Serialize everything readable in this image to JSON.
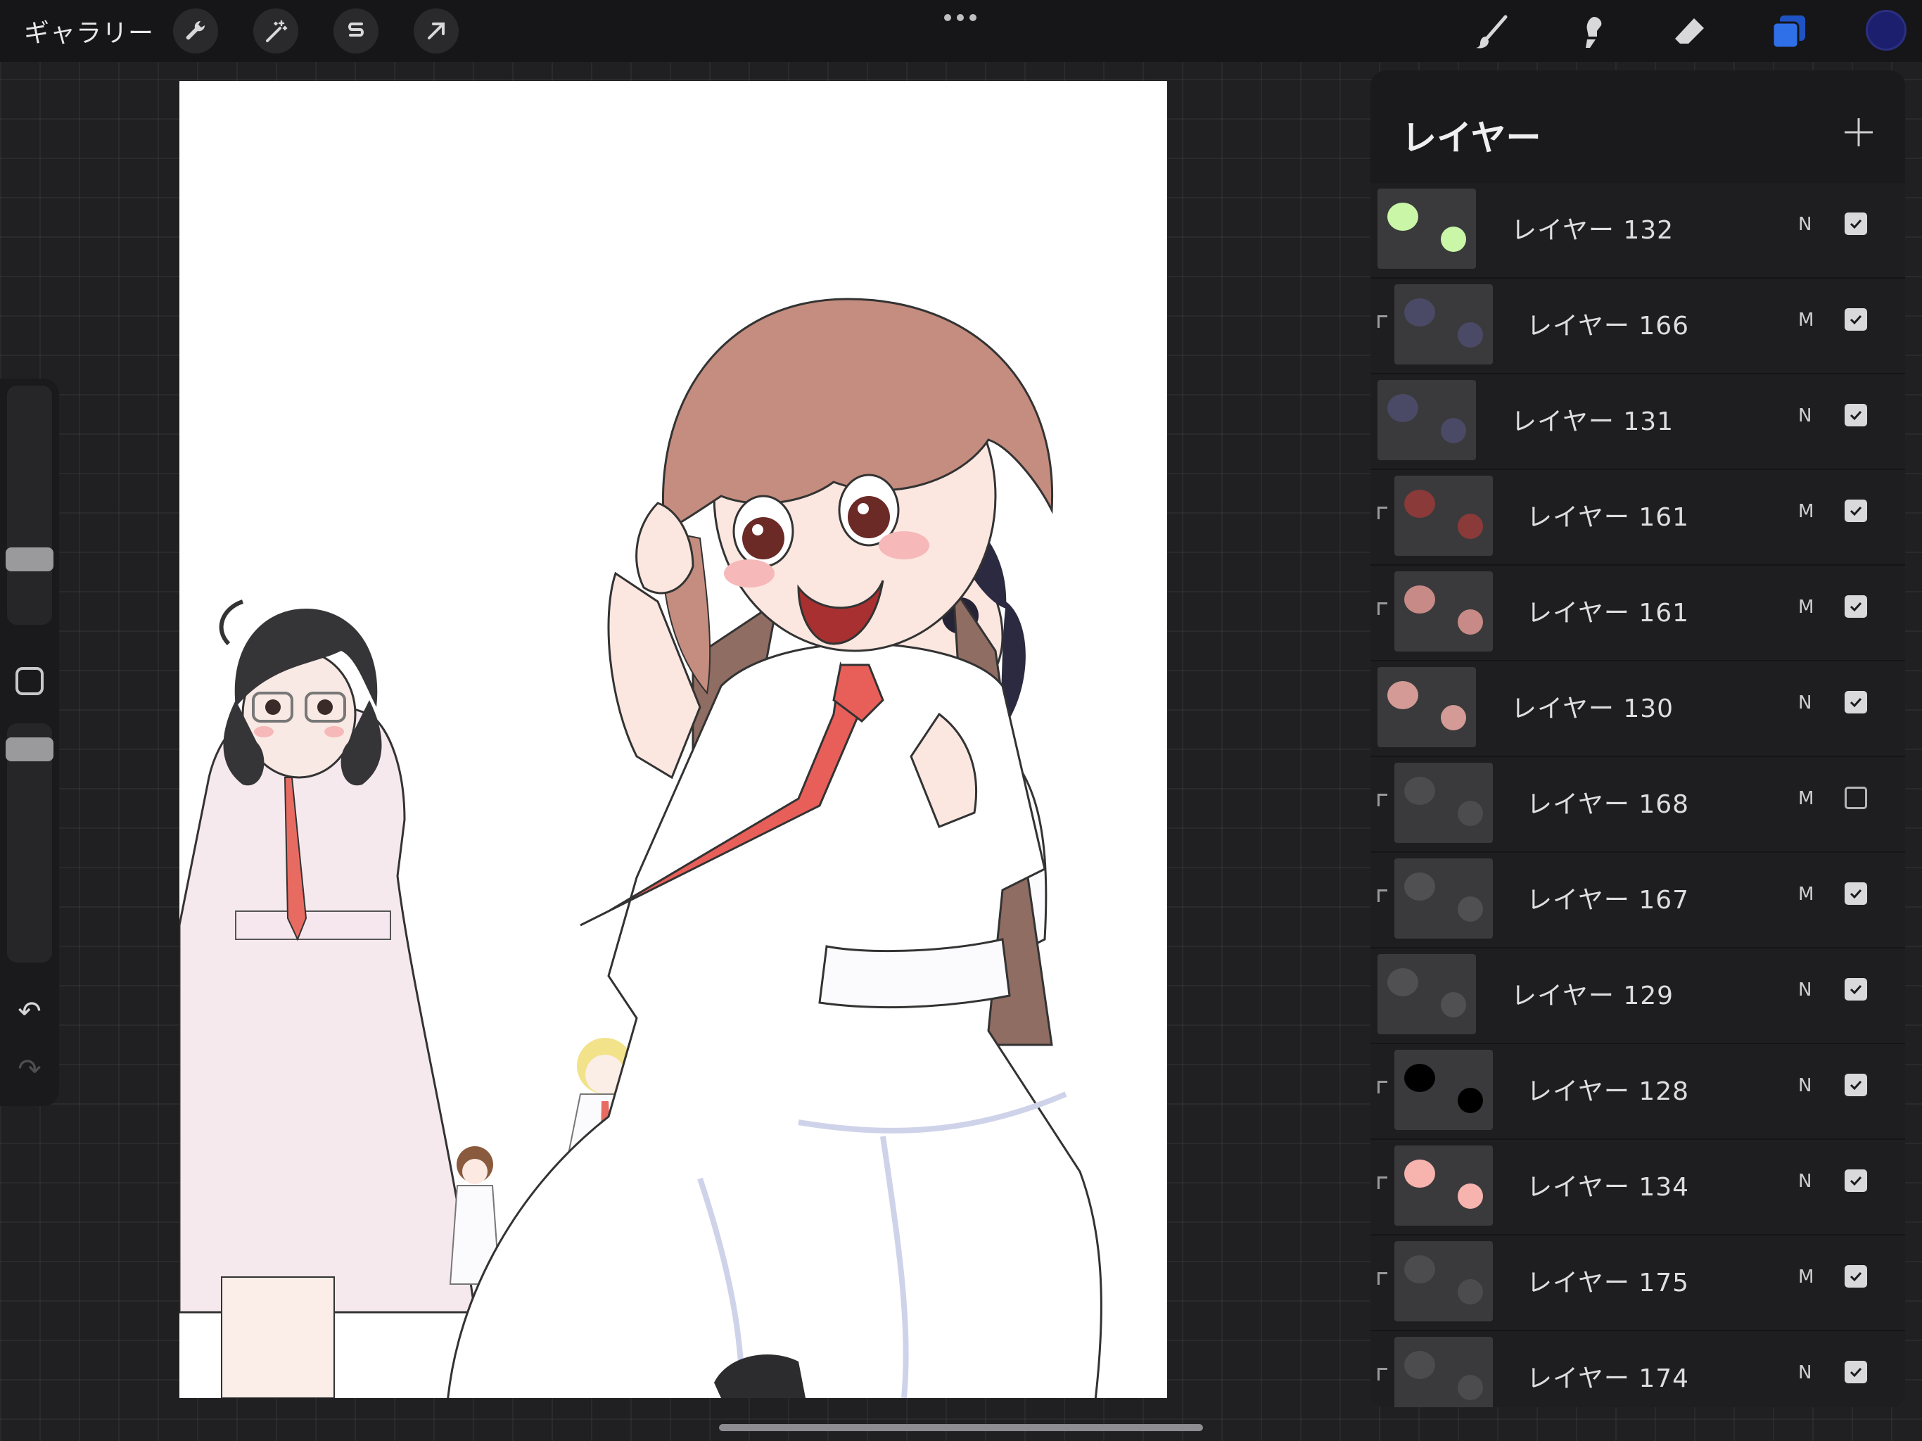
{
  "topbar": {
    "gallery_label": "ギャラリー",
    "left_tools": [
      "wrench-icon",
      "magic-wand-icon",
      "selection-s-icon",
      "arrow-transform-icon"
    ],
    "right_tools": [
      "brush-icon",
      "smudge-icon",
      "eraser-icon",
      "layers-icon"
    ],
    "active_tool": "layers-icon",
    "accent_color": "#2f6fe8",
    "current_color": "#1c1f6e"
  },
  "sidebar": {
    "brush_size_icon": "slider-knob",
    "modify_icon": "square-modify-icon",
    "undo_icon": "undo-icon",
    "redo_icon": "redo-icon"
  },
  "layers_panel": {
    "title": "レイヤー",
    "add_icon": "plus-icon",
    "layers": [
      {
        "name": "レイヤー 132",
        "blend": "N",
        "visible": true,
        "clipped": false,
        "thumb": "#c9f7a7"
      },
      {
        "name": "レイヤー 166",
        "blend": "M",
        "visible": true,
        "clipped": true,
        "thumb": "#4a4a66"
      },
      {
        "name": "レイヤー 131",
        "blend": "N",
        "visible": true,
        "clipped": false,
        "thumb": "#4a4a66"
      },
      {
        "name": "レイヤー 161",
        "blend": "M",
        "visible": true,
        "clipped": true,
        "thumb": "#8a3a38"
      },
      {
        "name": "レイヤー 161",
        "blend": "M",
        "visible": true,
        "clipped": true,
        "thumb": "#c88a86"
      },
      {
        "name": "レイヤー 130",
        "blend": "N",
        "visible": true,
        "clipped": false,
        "thumb": "#d49a96"
      },
      {
        "name": "レイヤー 168",
        "blend": "M",
        "visible": false,
        "clipped": true,
        "thumb": "#4c4c4e"
      },
      {
        "name": "レイヤー 167",
        "blend": "M",
        "visible": true,
        "clipped": true,
        "thumb": "#505052"
      },
      {
        "name": "レイヤー 129",
        "blend": "N",
        "visible": true,
        "clipped": false,
        "thumb": "#505052"
      },
      {
        "name": "レイヤー 128",
        "blend": "N",
        "visible": true,
        "clipped": true,
        "thumb": "#000000"
      },
      {
        "name": "レイヤー 134",
        "blend": "N",
        "visible": true,
        "clipped": true,
        "thumb": "#f7b3ae"
      },
      {
        "name": "レイヤー 175",
        "blend": "M",
        "visible": true,
        "clipped": true,
        "thumb": "#4c4c4e"
      },
      {
        "name": "レイヤー 174",
        "blend": "N",
        "visible": true,
        "clipped": true,
        "thumb": "#4c4c4e"
      }
    ]
  }
}
